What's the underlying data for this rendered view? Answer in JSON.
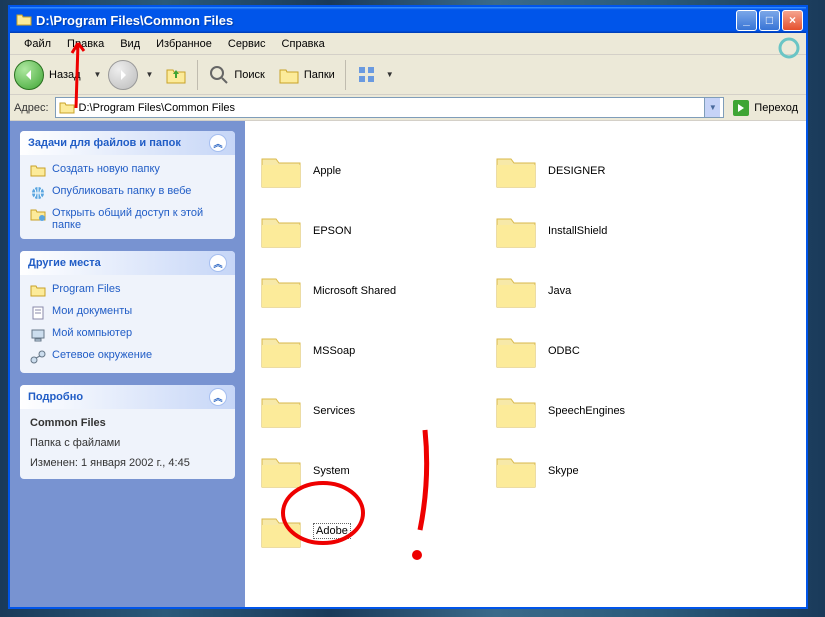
{
  "title": "D:\\Program Files\\Common Files",
  "menubar": [
    "Файл",
    "Правка",
    "Вид",
    "Избранное",
    "Сервис",
    "Справка"
  ],
  "toolbar": {
    "back": "Назад",
    "search": "Поиск",
    "folders": "Папки"
  },
  "address": {
    "label": "Адрес:",
    "value": "D:\\Program Files\\Common Files",
    "go": "Переход"
  },
  "panels": {
    "tasks": {
      "title": "Задачи для файлов и папок",
      "items": [
        "Создать новую папку",
        "Опубликовать папку в вебе",
        "Открыть общий доступ к этой папке"
      ]
    },
    "places": {
      "title": "Другие места",
      "items": [
        "Program Files",
        "Мои документы",
        "Мой компьютер",
        "Сетевое окружение"
      ]
    },
    "details": {
      "title": "Подробно",
      "name": "Common Files",
      "type": "Папка с файлами",
      "modified": "Изменен: 1 января 2002 г., 4:45"
    }
  },
  "folders": {
    "left": [
      "Apple",
      "EPSON",
      "Microsoft Shared",
      "MSSoap",
      "Services",
      "System",
      "Adobe"
    ],
    "right": [
      "DESIGNER",
      "InstallShield",
      "Java",
      "ODBC",
      "SpeechEngines",
      "Skype"
    ]
  }
}
